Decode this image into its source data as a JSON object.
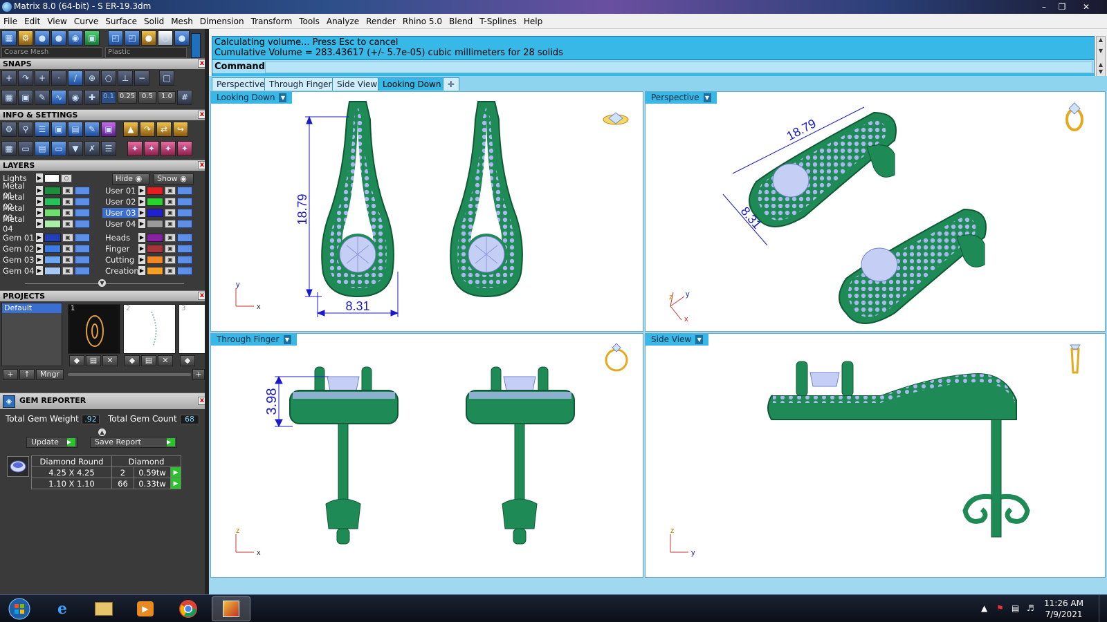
{
  "window": {
    "title": "Matrix 8.0 (64-bit) - S ER-19.3dm",
    "controls": [
      "minimize",
      "restore",
      "close"
    ]
  },
  "menu": [
    "File",
    "Edit",
    "View",
    "Curve",
    "Surface",
    "Solid",
    "Mesh",
    "Dimension",
    "Transform",
    "Tools",
    "Analyze",
    "Render",
    "Rhino 5.0",
    "Blend",
    "T-Splines",
    "Help"
  ],
  "left_panel": {
    "mesh_combo": "Coarse Mesh",
    "material_combo": "Plastic",
    "snaps_title": "SNAPS",
    "snap_values": [
      "0.1",
      "0.25",
      "0.5",
      "1.0"
    ],
    "info_title": "INFO & SETTINGS",
    "layers_title": "LAYERS",
    "lights_label": "Lights",
    "hide_label": "Hide",
    "show_label": "Show",
    "layers_left": [
      {
        "name": "Metal 01",
        "color": "#1a8f3c"
      },
      {
        "name": "Metal 02",
        "color": "#24c45a"
      },
      {
        "name": "Metal 03",
        "color": "#6de06d"
      },
      {
        "name": "Metal 04",
        "color": "#a8f0a8"
      },
      {
        "name": "Gem 01",
        "color": "#1f3fbf"
      },
      {
        "name": "Gem 02",
        "color": "#3a7be8"
      },
      {
        "name": "Gem 03",
        "color": "#6aa6f2"
      },
      {
        "name": "Gem 04",
        "color": "#a6c8f5"
      }
    ],
    "layers_right": [
      {
        "name": "User 01",
        "color": "#e81d1d"
      },
      {
        "name": "User 02",
        "color": "#22d62a"
      },
      {
        "name": "User 03",
        "color": "#1f1fd6",
        "selected": true
      },
      {
        "name": "User 04",
        "color": "#9a9a9a"
      },
      {
        "name": "Heads",
        "color": "#8a1fa8"
      },
      {
        "name": "Finger",
        "color": "#a8353a"
      },
      {
        "name": "Cutting",
        "color": "#f2891f"
      },
      {
        "name": "Creation",
        "color": "#f5a11f"
      }
    ],
    "projects_title": "PROJECTS",
    "project_default": "Default",
    "project_thumbs": [
      "1",
      "2",
      "3"
    ],
    "projects_mngr": "Mngr",
    "gem_reporter_title": "GEM REPORTER",
    "total_weight_label": "Total Gem Weight",
    "total_weight_value": ".92",
    "total_count_label": "Total Gem Count",
    "total_count_value": "68",
    "update_label": "Update",
    "save_report_label": "Save Report",
    "gem_table": {
      "headers": [
        "Diamond Round",
        "Diamond"
      ],
      "rows": [
        {
          "size": "4.25 X 4.25",
          "count": "2",
          "weight": "0.59tw"
        },
        {
          "size": "1.10 X 1.10",
          "count": "66",
          "weight": "0.33tw"
        }
      ]
    }
  },
  "command": {
    "line1": "Calculating volume... Press Esc to cancel",
    "line2": "Cumulative Volume = 283.43617 (+/- 5.7e-05) cubic millimeters for 28 solids",
    "label": "Command:"
  },
  "viewport_tabs": [
    "Perspective",
    "Through Finger",
    "Side View",
    "Looking Down"
  ],
  "active_tab": "Looking Down",
  "viewports": {
    "top_left": {
      "label": "Looking Down",
      "dim_height": "18.79",
      "dim_width": "8.31",
      "axis_v": "y",
      "axis_h": "x"
    },
    "top_right": {
      "label": "Perspective",
      "dim_length": "18.79",
      "dim_width": "8.31",
      "axis_a": "z",
      "axis_b": "y",
      "axis_c": "x"
    },
    "bottom_left": {
      "label": "Through Finger",
      "dim_height": "3.98",
      "axis_v": "z",
      "axis_h": "x"
    },
    "bottom_right": {
      "label": "Side View",
      "axis_v": "z",
      "axis_h": "y"
    }
  },
  "colors": {
    "metal": "#1e8a55",
    "metal_dark": "#0f5a35",
    "gem": "#a9b9f0",
    "dimension": "#1a1ac8",
    "viewport_label_bg": "#37b8e6"
  },
  "taskbar": {
    "time": "11:26 AM",
    "date": "7/9/2021",
    "items": [
      "start-orb",
      "internet-explorer",
      "file-explorer",
      "media-player",
      "chrome",
      "matrix"
    ]
  }
}
